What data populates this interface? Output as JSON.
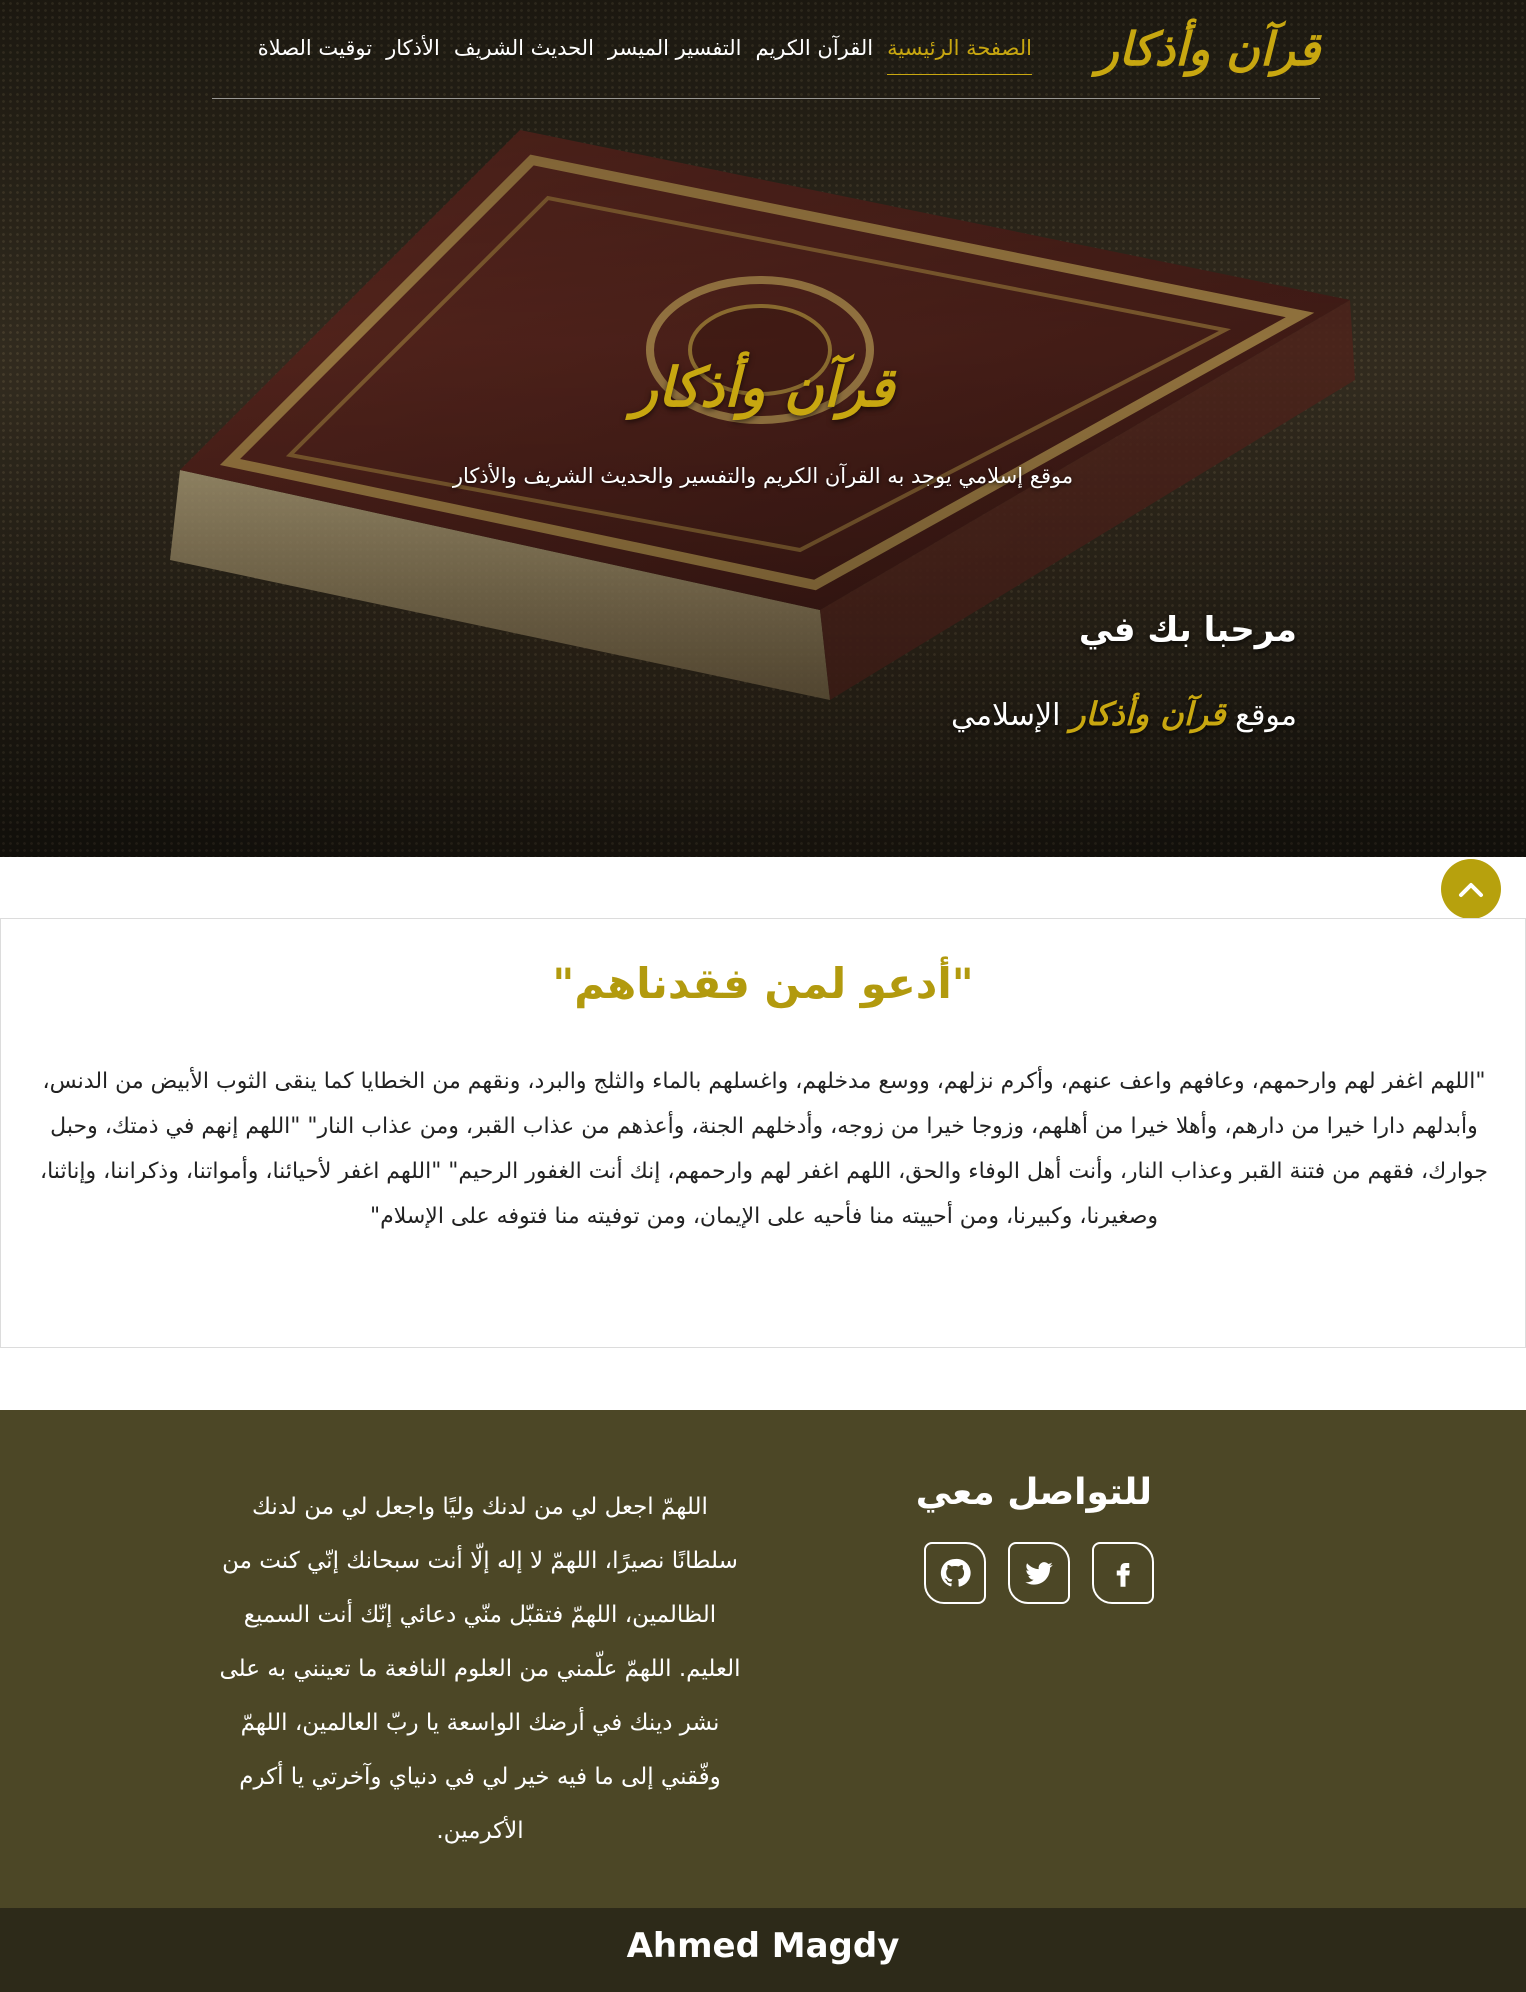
{
  "nav": {
    "logo": "قرآن وأذكار",
    "items": [
      {
        "label": "الصفحة الرئيسية",
        "active": true
      },
      {
        "label": "القرآن الكريم",
        "active": false
      },
      {
        "label": "التفسير الميسر",
        "active": false
      },
      {
        "label": "الحديث الشريف",
        "active": false
      },
      {
        "label": "الأذكار",
        "active": false
      },
      {
        "label": "توقيت الصلاة",
        "active": false
      }
    ]
  },
  "hero": {
    "title": "قرآن وأذكار",
    "subtitle": "موقع إسلامي يوجد به القرآن الكريم والتفسير والحديث الشريف والأذكار",
    "welcome_line1": "مرحبا بك في",
    "welcome_prefix": "موقع",
    "welcome_brand": "قرآن وأذكار",
    "welcome_suffix": "الإسلامي"
  },
  "scroll_top": {
    "icon": "chevron-up-icon"
  },
  "dua": {
    "title": "\"أدعو لمن فقدناهم\"",
    "text": "\"اللهم اغفر لهم وارحمهم، وعافهم واعف عنهم، وأكرم نزلهم، ووسع مدخلهم، واغسلهم بالماء والثلج والبرد، ونقهم من الخطايا كما ينقى الثوب الأبيض من الدنس، وأبدلهم دارا خيرا من دارهم، وأهلا خيرا من أهلهم، وزوجا خيرا من زوجه، وأدخلهم الجنة، وأعذهم من عذاب القبر، ومن عذاب النار\" \"اللهم إنهم في ذمتك، وحبل جوارك، فقهم من فتنة القبر وعذاب النار، وأنت أهل الوفاء والحق، اللهم اغفر لهم وارحمهم، إنك أنت الغفور الرحيم\" \"اللهم اغفر لأحيائنا، وأمواتنا، وذكراننا، وإناثنا، وصغيرنا، وكبيرنا، ومن أحييته منا فأحيه على الإيمان، ومن توفيته منا فتوفه على الإسلام\""
  },
  "footer": {
    "contact_title": "للتواصل معي",
    "social": [
      {
        "icon": "facebook-icon"
      },
      {
        "icon": "twitter-icon"
      },
      {
        "icon": "github-icon"
      }
    ],
    "dua_text": "اللهمّ اجعل لي من لدنك وليًا واجعل لي من لدنك سلطانًا نصيرًا، اللهمّ لا إله إلّا أنت سبحانك إنّي كنت من الظالمين، اللهمّ فتقبّل منّي دعائي إنّك أنت السميع العليم. اللهمّ علّمني من العلوم النافعة ما تعينني به على نشر دينك في أرضك الواسعة يا ربّ العالمين، اللهمّ وفّقني إلى ما فيه خير لي في دنياي وآخرتي يا أكرم الأكرمين.",
    "author": "Ahmed Magdy"
  },
  "colors": {
    "accent": "#c8a710",
    "footer_bg": "#4c4726",
    "bottom_bar_bg": "#2d2a19"
  }
}
